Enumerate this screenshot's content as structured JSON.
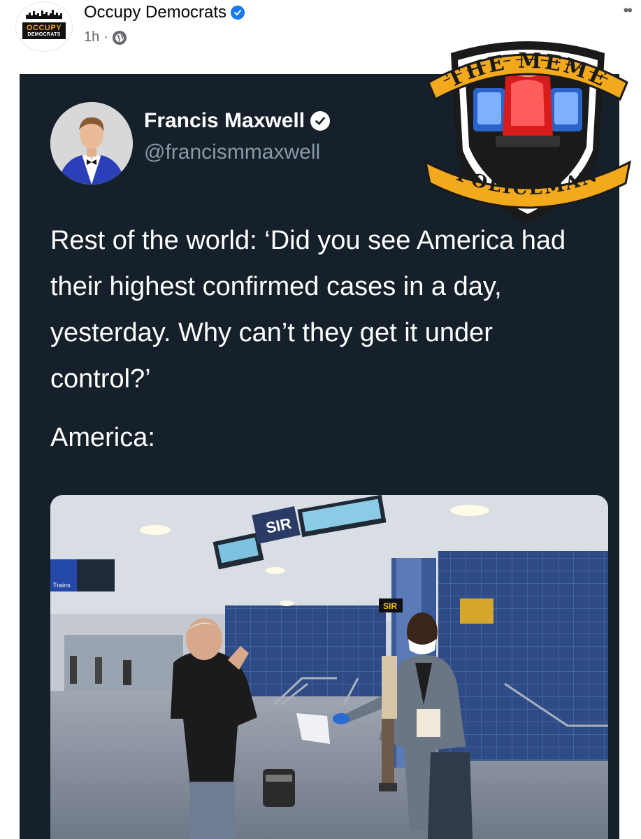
{
  "post": {
    "page_name": "Occupy Democrats",
    "time": "1h",
    "separator": "·",
    "more_label": "••",
    "avatar_logo": {
      "line1": "OCCUPY",
      "line2": "DEMOCRATS"
    }
  },
  "tweet": {
    "name": "Francis Maxwell",
    "handle": "@francismmaxwell",
    "text": "Rest of the world: ‘Did you see America had their highest confirmed cases in a day, yesterday. Why can’t they get it under control?’",
    "text2": "America:",
    "photo_signs": {
      "sir": "SIR",
      "sir_small": "SIR",
      "trains": "Trains"
    }
  },
  "watermark": {
    "top": "THE MEME",
    "bottom": "POLICEMAN"
  },
  "colors": {
    "tweet_bg": "#15202b",
    "fb_verified": "#1877f2",
    "handle": "#8899a6"
  }
}
